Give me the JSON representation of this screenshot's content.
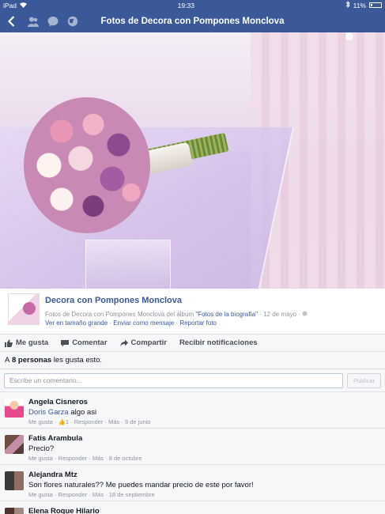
{
  "status": {
    "device": "iPad",
    "time": "19:33",
    "battery": "11%"
  },
  "nav": {
    "title": "Fotos de Decora con Pompones Monclova"
  },
  "photo": {
    "watermark": ""
  },
  "post": {
    "page_name": "Decora con Pompones Monclova",
    "meta_prefix": "Fotos de Decora con Pompones Monclova del álbum",
    "album": "\"Fotos de la biografía\"",
    "date": "· 12 de mayo ·",
    "link_view": "Ver en tamaño grande",
    "link_send": "Enviar como mensaje",
    "link_report": "Reportar foto"
  },
  "actions": {
    "like": "Me gusta",
    "comment": "Comentar",
    "share": "Compartir",
    "notify": "Recibir notificaciones"
  },
  "likes": {
    "prefix": "A",
    "count": "8 personas",
    "suffix": "les gusta esto."
  },
  "composer": {
    "placeholder": "Escribe un comentario...",
    "publish": "Publicar"
  },
  "comments": [
    {
      "name": "Angela Cisneros",
      "mention": "Doris Garza",
      "text": "algo asi",
      "like": "Me gusta",
      "likes": "1",
      "reply": "Responder",
      "more": "Más",
      "date": "9 de junio"
    },
    {
      "name": "Fatis Arambula",
      "text": "Precio?",
      "like": "Me gusta",
      "reply": "Responder",
      "more": "Más",
      "date": "8 de octubre"
    },
    {
      "name": "Alejandra Mtz",
      "text": "Son flores naturales?? Me puedes mandar precio de este por favor!",
      "like": "Me gusta",
      "reply": "Responder",
      "more": "Más",
      "date": "18 de septiembre"
    },
    {
      "name": "Elena Roque Hilario"
    }
  ],
  "colors": {
    "brand": "#3b5998",
    "muted": "#90949c"
  }
}
